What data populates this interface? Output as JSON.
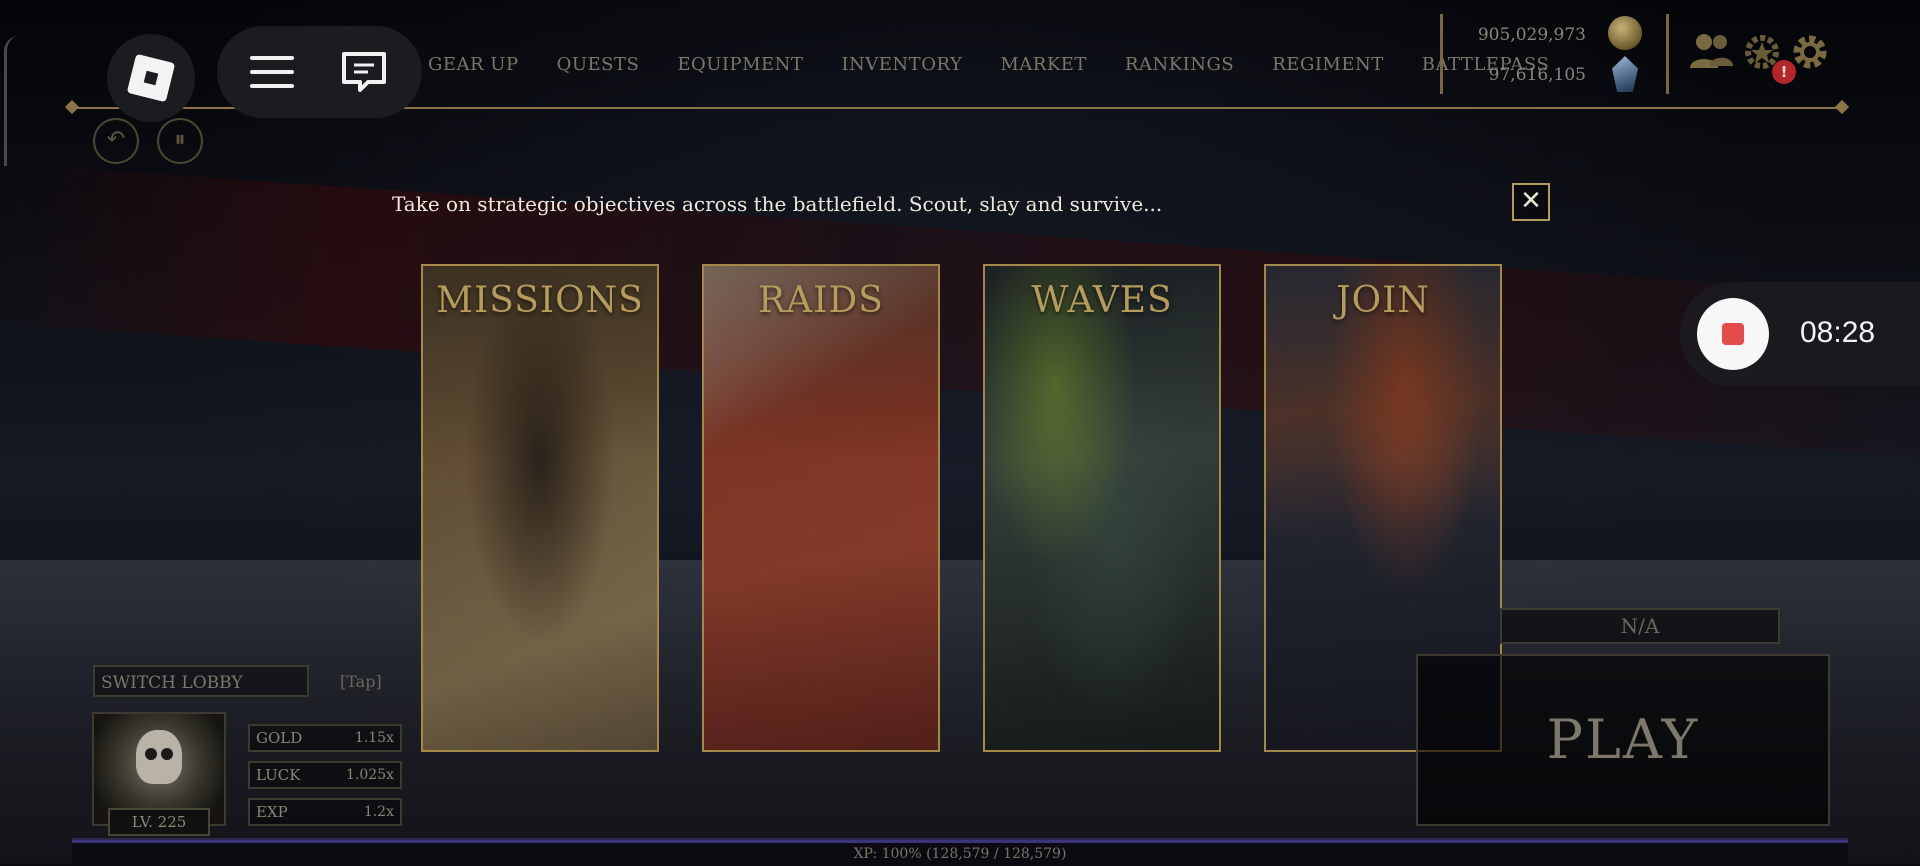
{
  "nav": {
    "items": [
      "GEAR UP",
      "QUESTS",
      "EQUIPMENT",
      "INVENTORY",
      "MARKET",
      "RANKINGS",
      "REGIMENT",
      "BATTLEPASS"
    ]
  },
  "currency": {
    "gold": "905,029,973",
    "gems": "97,616,105"
  },
  "notification_count": "!",
  "modes_panel": {
    "description": "Take on strategic objectives across the battlefield. Scout, slay and survive...",
    "close_label": "✕",
    "cards": [
      {
        "title": "MISSIONS"
      },
      {
        "title": "RAIDS"
      },
      {
        "title": "WAVES"
      },
      {
        "title": "JOIN"
      }
    ]
  },
  "recording": {
    "time": "08:28"
  },
  "lobby": {
    "switch_label": "SWITCH LOBBY",
    "tap_label": "[Tap]"
  },
  "player": {
    "level": "LV. 225",
    "stats": [
      {
        "name": "GOLD",
        "value": "1.15x"
      },
      {
        "name": "LUCK",
        "value": "1.025x"
      },
      {
        "name": "EXP",
        "value": "1.2x"
      }
    ]
  },
  "play": {
    "status": "N/A",
    "button_label": "PLAY"
  },
  "xp": {
    "text": "XP: 100% (128,579 / 128,579)",
    "progress": 1.0
  },
  "colors": {
    "gold_accent": "#a48848",
    "record_red": "#e44c4c",
    "notification_red": "#b3262a"
  }
}
